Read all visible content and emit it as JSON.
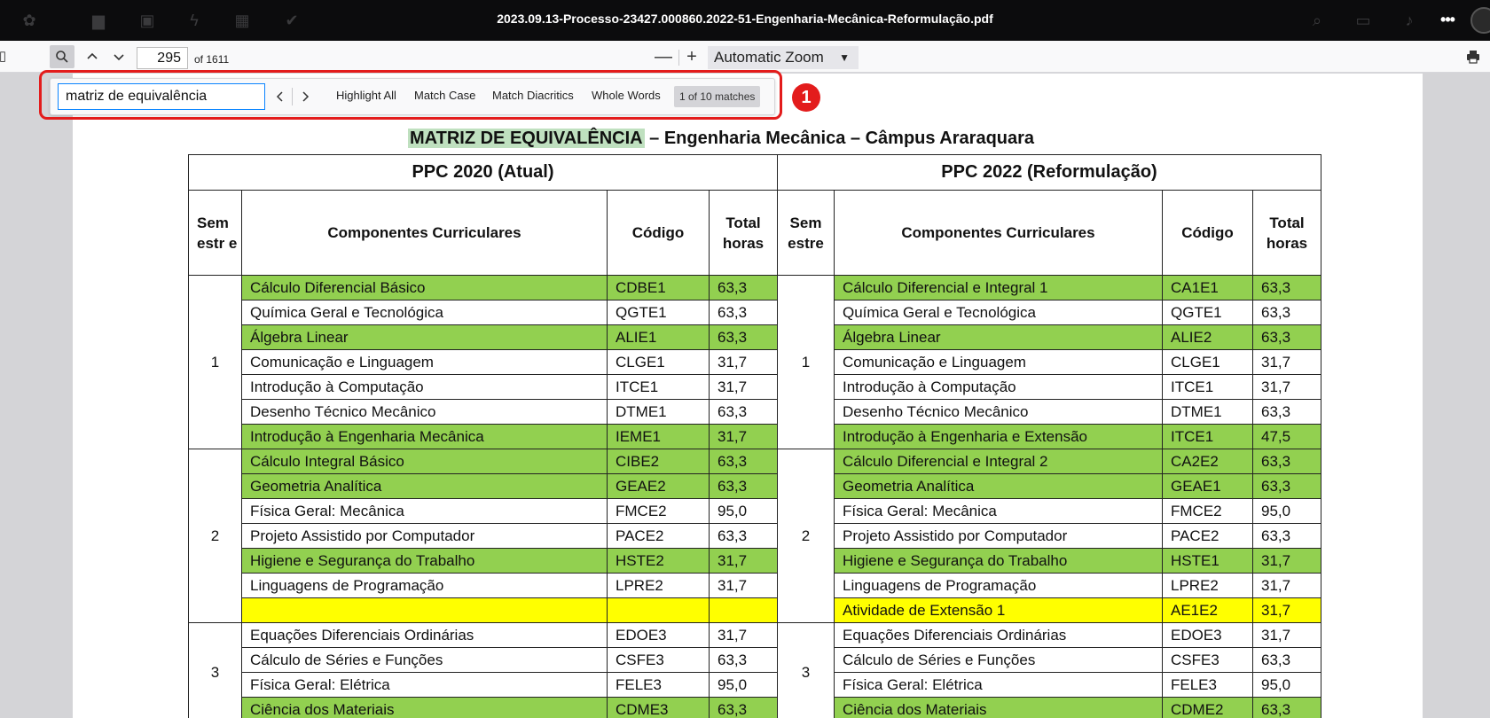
{
  "window": {
    "title": "2023.09.13-Processo-23427.000860.2022-51-Engenharia-Mecânica-Reformulação.pdf"
  },
  "toolbar": {
    "page_number": "295",
    "page_count": "of 1611",
    "zoom": "Automatic Zoom",
    "zoom_out": "—",
    "zoom_in": "+"
  },
  "findbar": {
    "query": "matriz de equivalência",
    "highlight_all": "Highlight All",
    "match_case": "Match Case",
    "match_diacritics": "Match Diacritics",
    "whole_words": "Whole Words",
    "result": "1 of 10 matches"
  },
  "annotation": {
    "badge": "1"
  },
  "document": {
    "heading_match": "MATRIZ DE EQUIVALÊNCIA",
    "heading_rest": " – Engenharia Mecânica – Câmpus Araraquara",
    "left_title": "PPC 2020 (Atual)",
    "right_title": "PPC 2022 (Reformulação)",
    "headers": {
      "sem_left": "Sem estr e",
      "sem_right": "Sem estre",
      "components": "Componentes Curriculares",
      "code": "Código",
      "hours": "Total horas"
    },
    "rows": [
      {
        "color": "green",
        "ln": "Cálculo Diferencial Básico",
        "lc": "CDBE1",
        "lh": "63,3",
        "rn": "Cálculo Diferencial e Integral 1",
        "rc": "CA1E1",
        "rh": "63,3"
      },
      {
        "color": "white",
        "ln": "Química Geral e Tecnológica",
        "lc": "QGTE1",
        "lh": "63,3",
        "rn": "Química Geral e Tecnológica",
        "rc": "QGTE1",
        "rh": "63,3"
      },
      {
        "color": "green",
        "ln": "Álgebra Linear",
        "lc": "ALIE1",
        "lh": "63,3",
        "rn": "Álgebra Linear",
        "rc": "ALIE2",
        "rh": "63,3"
      },
      {
        "color": "white",
        "ln": "Comunicação e Linguagem",
        "lc": "CLGE1",
        "lh": "31,7",
        "rn": "Comunicação e Linguagem",
        "rc": "CLGE1",
        "rh": "31,7"
      },
      {
        "color": "white",
        "ln": "Introdução à Computação",
        "lc": "ITCE1",
        "lh": "31,7",
        "rn": "Introdução à Computação",
        "rc": "ITCE1",
        "rh": "31,7"
      },
      {
        "color": "white",
        "ln": "Desenho Técnico Mecânico",
        "lc": "DTME1",
        "lh": "63,3",
        "rn": "Desenho Técnico Mecânico",
        "rc": "DTME1",
        "rh": "63,3"
      },
      {
        "color": "green",
        "ln": "Introdução à Engenharia Mecânica",
        "lc": "IEME1",
        "lh": "31,7",
        "rn": "Introdução à Engenharia e Extensão",
        "rc": "ITCE1",
        "rh": "47,5"
      },
      {
        "color": "green",
        "ln": "Cálculo Integral Básico",
        "lc": "CIBE2",
        "lh": "63,3",
        "rn": "Cálculo Diferencial e Integral 2",
        "rc": "CA2E2",
        "rh": "63,3"
      },
      {
        "color": "green",
        "ln": "Geometria Analítica",
        "lc": "GEAE2",
        "lh": "63,3",
        "rn": "Geometria Analítica",
        "rc": "GEAE1",
        "rh": "63,3"
      },
      {
        "color": "white",
        "ln": "Física Geral: Mecânica",
        "lc": "FMCE2",
        "lh": "95,0",
        "rn": "Física Geral: Mecânica",
        "rc": "FMCE2",
        "rh": "95,0"
      },
      {
        "color": "white",
        "ln": "Projeto Assistido por Computador",
        "lc": "PACE2",
        "lh": "63,3",
        "rn": "Projeto Assistido por Computador",
        "rc": "PACE2",
        "rh": "63,3"
      },
      {
        "color": "green",
        "ln": "Higiene e Segurança do Trabalho",
        "lc": "HSTE2",
        "lh": "31,7",
        "rn": "Higiene e Segurança do Trabalho",
        "rc": "HSTE1",
        "rh": "31,7"
      },
      {
        "color": "white",
        "ln": "Linguagens de Programação",
        "lc": "LPRE2",
        "lh": "31,7",
        "rn": "Linguagens de Programação",
        "rc": "LPRE2",
        "rh": "31,7"
      },
      {
        "color": "yellow",
        "ln": "",
        "lc": "",
        "lh": "",
        "rn": "Atividade de Extensão 1",
        "rc": "AE1E2",
        "rh": "31,7"
      },
      {
        "color": "white",
        "ln": "Equações Diferenciais Ordinárias",
        "lc": "EDOE3",
        "lh": "31,7",
        "rn": "Equações Diferenciais Ordinárias",
        "rc": "EDOE3",
        "rh": "31,7"
      },
      {
        "color": "white",
        "ln": "Cálculo de Séries e Funções",
        "lc": "CSFE3",
        "lh": "63,3",
        "rn": "Cálculo de Séries e Funções",
        "rc": "CSFE3",
        "rh": "63,3"
      },
      {
        "color": "white",
        "ln": "Física Geral: Elétrica",
        "lc": "FELE3",
        "lh": "95,0",
        "rn": "Física Geral: Elétrica",
        "rc": "FELE3",
        "rh": "95,0"
      },
      {
        "color": "green",
        "ln": "Ciência dos Materiais",
        "lc": "CDME3",
        "lh": "63,3",
        "rn": "Ciência dos Materiais",
        "rc": "CDME2",
        "rh": "63,3"
      }
    ],
    "semesters": [
      {
        "label": "1",
        "start": 0,
        "span": 7
      },
      {
        "label": "2",
        "start": 7,
        "span": 7
      },
      {
        "label": "3",
        "start": 14,
        "span": 4
      }
    ]
  }
}
